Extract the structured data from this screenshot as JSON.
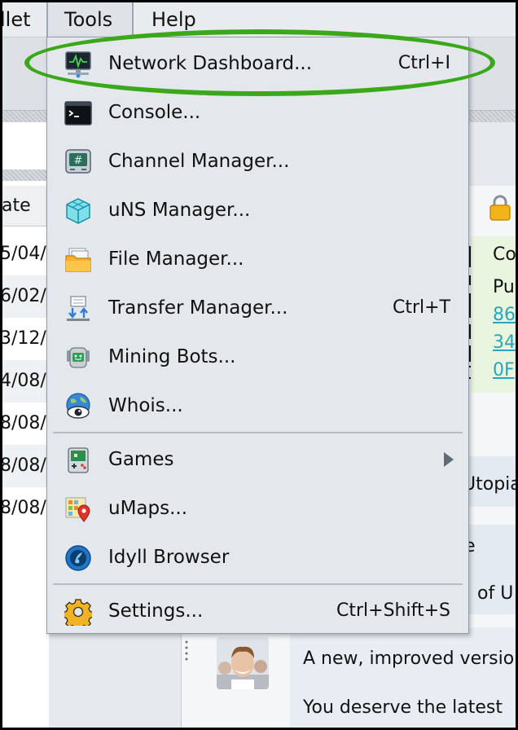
{
  "menubar": {
    "wallet_label": "llet",
    "tools_label": "Tools",
    "help_label": "Help"
  },
  "left_list": {
    "header": "ate",
    "rows": [
      "5/04/",
      "6/02/",
      "3/12/",
      "4/08/",
      "8/08/",
      "8/08/",
      "8/08/"
    ]
  },
  "right_content": {
    "card_line1": "Co",
    "card_line2": "Pu",
    "links": [
      "86",
      "34",
      "0F"
    ],
    "bubble_utopia": "Utopia",
    "bubble_e": "e",
    "bubble_of_u": "of U",
    "news_line1": "A new, improved versio",
    "news_line2": "You deserve the latest"
  },
  "tools_menu": {
    "items": [
      {
        "label": "Network Dashboard...",
        "shortcut": "Ctrl+I",
        "icon": "network-dashboard-icon"
      },
      {
        "label": "Console...",
        "shortcut": "",
        "icon": "console-icon"
      },
      {
        "label": "Channel Manager...",
        "shortcut": "",
        "icon": "channel-manager-icon"
      },
      {
        "label": "uNS Manager...",
        "shortcut": "",
        "icon": "uns-manager-icon"
      },
      {
        "label": "File Manager...",
        "shortcut": "",
        "icon": "folder-icon"
      },
      {
        "label": "Transfer Manager...",
        "shortcut": "Ctrl+T",
        "icon": "transfer-icon"
      },
      {
        "label": "Mining Bots...",
        "shortcut": "",
        "icon": "mining-bot-icon"
      },
      {
        "label": "Whois...",
        "shortcut": "",
        "icon": "whois-globe-icon"
      }
    ],
    "items2": [
      {
        "label": "Games",
        "icon": "games-icon",
        "has_submenu": true
      },
      {
        "label": "uMaps...",
        "icon": "umaps-icon"
      },
      {
        "label": "Idyll Browser",
        "icon": "idyll-browser-icon"
      }
    ],
    "items3": [
      {
        "label": "Settings...",
        "shortcut": "Ctrl+Shift+S",
        "icon": "gear-icon"
      }
    ]
  },
  "colors": {
    "highlight_oval": "#3aa81a",
    "menu_bg": "#e4e8ec",
    "link": "#2aa6b8",
    "green_card": "#eaf5df"
  }
}
